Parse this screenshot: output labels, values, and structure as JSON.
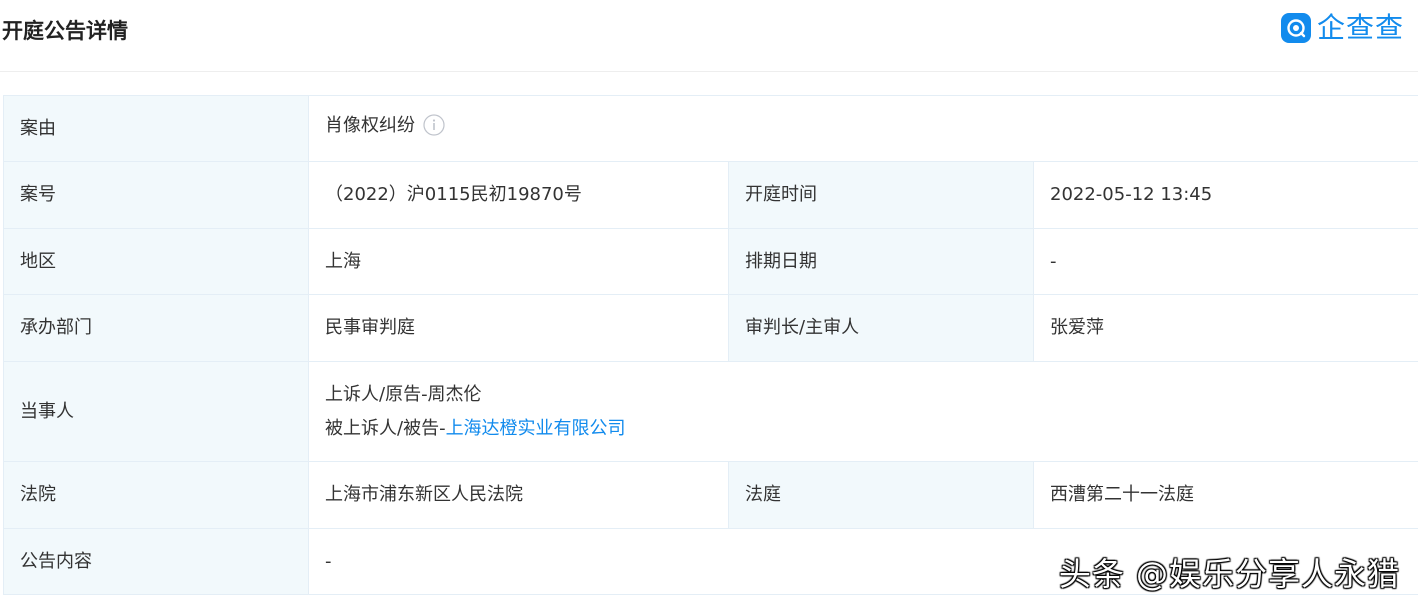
{
  "page": {
    "title": "开庭公告详情"
  },
  "brand": {
    "name": "企查查",
    "logo_icon": "qcc-logo-icon",
    "color": "#128bed"
  },
  "table": {
    "case_reason": {
      "label": "案由",
      "value": "肖像权纠纷",
      "icon": "info-icon"
    },
    "case_number": {
      "label": "案号",
      "value": "（2022）沪0115民初19870号"
    },
    "hearing_time": {
      "label": "开庭时间",
      "value": "2022-05-12 13:45"
    },
    "region": {
      "label": "地区",
      "value": "上海"
    },
    "schedule_date": {
      "label": "排期日期",
      "value": "-"
    },
    "department": {
      "label": "承办部门",
      "value": "民事审判庭"
    },
    "judge": {
      "label": "审判长/主审人",
      "value": "张爱萍"
    },
    "parties": {
      "label": "当事人",
      "line1": "上诉人/原告-周杰伦",
      "line2_prefix": "被上诉人/被告-",
      "line2_link": "上海达橙实业有限公司"
    },
    "court": {
      "label": "法院",
      "value": "上海市浦东新区人民法院"
    },
    "courtroom": {
      "label": "法庭",
      "value": "西漕第二十一法庭"
    },
    "announcement": {
      "label": "公告内容",
      "value": "-"
    }
  },
  "watermark": "头条 @娱乐分享人永猎",
  "colors": {
    "label_bg": "#f2f9fc",
    "border": "#e4eef6",
    "link": "#128bed"
  }
}
